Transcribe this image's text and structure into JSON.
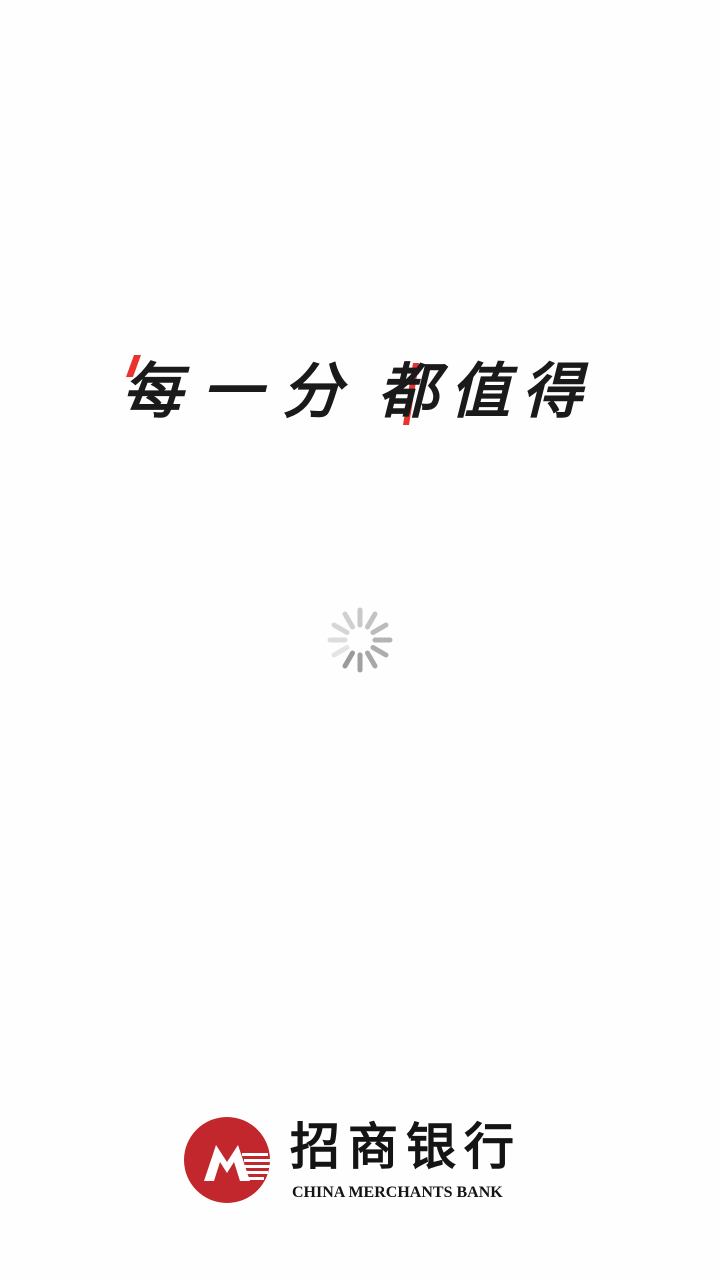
{
  "splash": {
    "slogan_part1": "每一分",
    "slogan_part2": "都值得",
    "loading_indicator": "spinner"
  },
  "brand": {
    "name_cn": "招商银行",
    "name_en": "CHINA MERCHANTS BANK",
    "logo_icon": "cmb-logo-icon"
  },
  "colors": {
    "background": "#fefefe",
    "text": "#1a1a1a",
    "accent_red": "#e8332f",
    "logo_red": "#c1272d",
    "spinner_gray": "#9a9a9a"
  }
}
